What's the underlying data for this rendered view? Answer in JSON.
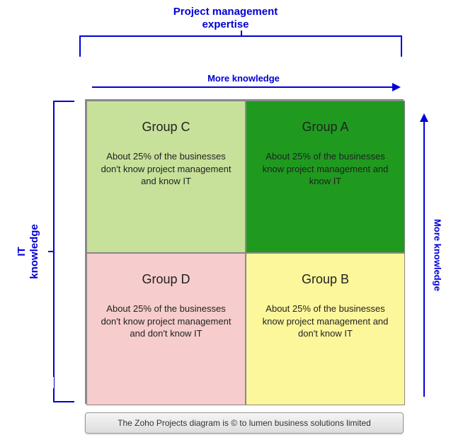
{
  "titles": {
    "top": "Project management\nexpertise",
    "left": "IT\nknowledge"
  },
  "arrows": {
    "top_label": "More knowledge",
    "right_label": "More knowledge"
  },
  "cells": {
    "c": {
      "title": "Group C",
      "desc": "About 25% of the businesses don't know project management and know IT",
      "color": "#c8e19a"
    },
    "a": {
      "title": "Group A",
      "desc": "About 25% of the businesses know project management and know IT",
      "color": "#1f9a1f"
    },
    "d": {
      "title": "Group D",
      "desc": "About 25% of the businesses don't know project management and don't know IT",
      "color": "#f6cccc"
    },
    "b": {
      "title": "Group B",
      "desc": "About 25% of the businesses know project management and don't know IT",
      "color": "#fdf79b"
    }
  },
  "caption": "The Zoho Projects diagram is © to lumen business solutions limited"
}
